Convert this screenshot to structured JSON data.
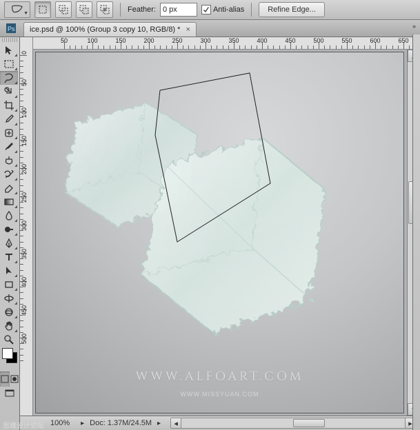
{
  "options_bar": {
    "feather_label": "Feather:",
    "feather_value": "0 px",
    "anti_alias_label": "Anti-alias",
    "anti_alias_checked": true,
    "refine_edge_label": "Refine Edge..."
  },
  "document_tab": {
    "title": "ice.psd @ 100% (Group 3 copy 10, RGB/8) *"
  },
  "ruler": {
    "h_ticks": [
      50,
      100,
      150,
      200,
      250,
      300,
      350,
      400,
      450,
      500,
      550,
      600,
      650
    ],
    "v_ticks": [
      0,
      50,
      100,
      150,
      200,
      250,
      300,
      350,
      400,
      450,
      500
    ]
  },
  "watermark": {
    "main": "WWW.ALFOART.COM",
    "secondary": "WWW.MISSYUAN.COM"
  },
  "status": {
    "zoom": "100%",
    "doc_info": "Doc: 1.37M/24.5M"
  },
  "tools": {
    "names": [
      "move",
      "rect-marquee",
      "lasso",
      "magic-wand",
      "crop",
      "eyedropper",
      "healing-brush",
      "brush",
      "clone-stamp",
      "history-brush",
      "eraser",
      "gradient",
      "blur",
      "dodge",
      "pen",
      "type",
      "path-select",
      "shape",
      "3d-rotate",
      "3d-orbit",
      "hand",
      "zoom"
    ]
  },
  "brand_corner": "思维设计论坛"
}
